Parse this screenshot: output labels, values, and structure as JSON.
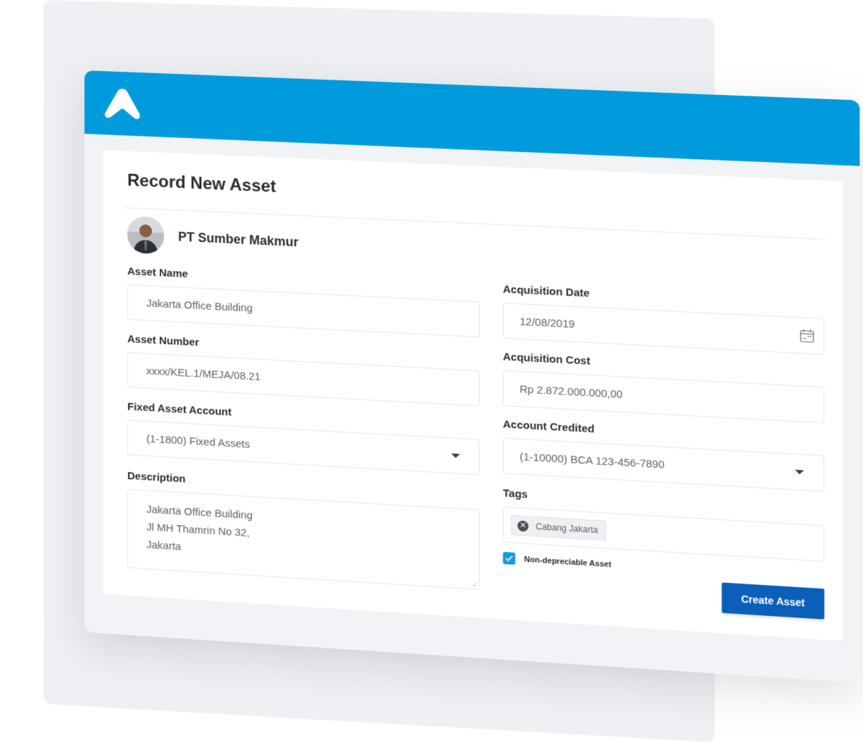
{
  "app": {
    "logo": "app-logo-icon"
  },
  "form": {
    "title": "Record New Asset",
    "company": {
      "name": "PT Sumber Makmur",
      "avatar": "avatar"
    },
    "asset_name": {
      "label": "Asset Name",
      "value": "Jakarta Office Building"
    },
    "asset_number": {
      "label": "Asset Number",
      "value": "xxxx/KEL.1/MEJA/08.21"
    },
    "fixed_asset_account": {
      "label": "Fixed Asset Account",
      "value": "(1-1800) Fixed Assets"
    },
    "description": {
      "label": "Description",
      "lines": [
        "Jakarta Office Building",
        "Jl MH Thamrin No 32,",
        "Jakarta"
      ]
    },
    "acquisition_date": {
      "label": "Acquisition Date",
      "value": "12/08/2019",
      "icon": "calendar-icon"
    },
    "acquisition_cost": {
      "label": "Acquisition Cost",
      "value": "Rp 2.872.000.000,00"
    },
    "account_credited": {
      "label": "Account Credited",
      "value": "(1-10000) BCA 123-456-7890"
    },
    "tags": {
      "label": "Tags",
      "items": [
        "Cabang Jakarta"
      ]
    },
    "non_depreciable": {
      "label": "Non-depreciable Asset",
      "checked": true
    },
    "submit_label": "Create Asset"
  },
  "colors": {
    "brand": "#009bdd",
    "button": "#0c5fb8",
    "checkbox": "#1a99dc"
  }
}
